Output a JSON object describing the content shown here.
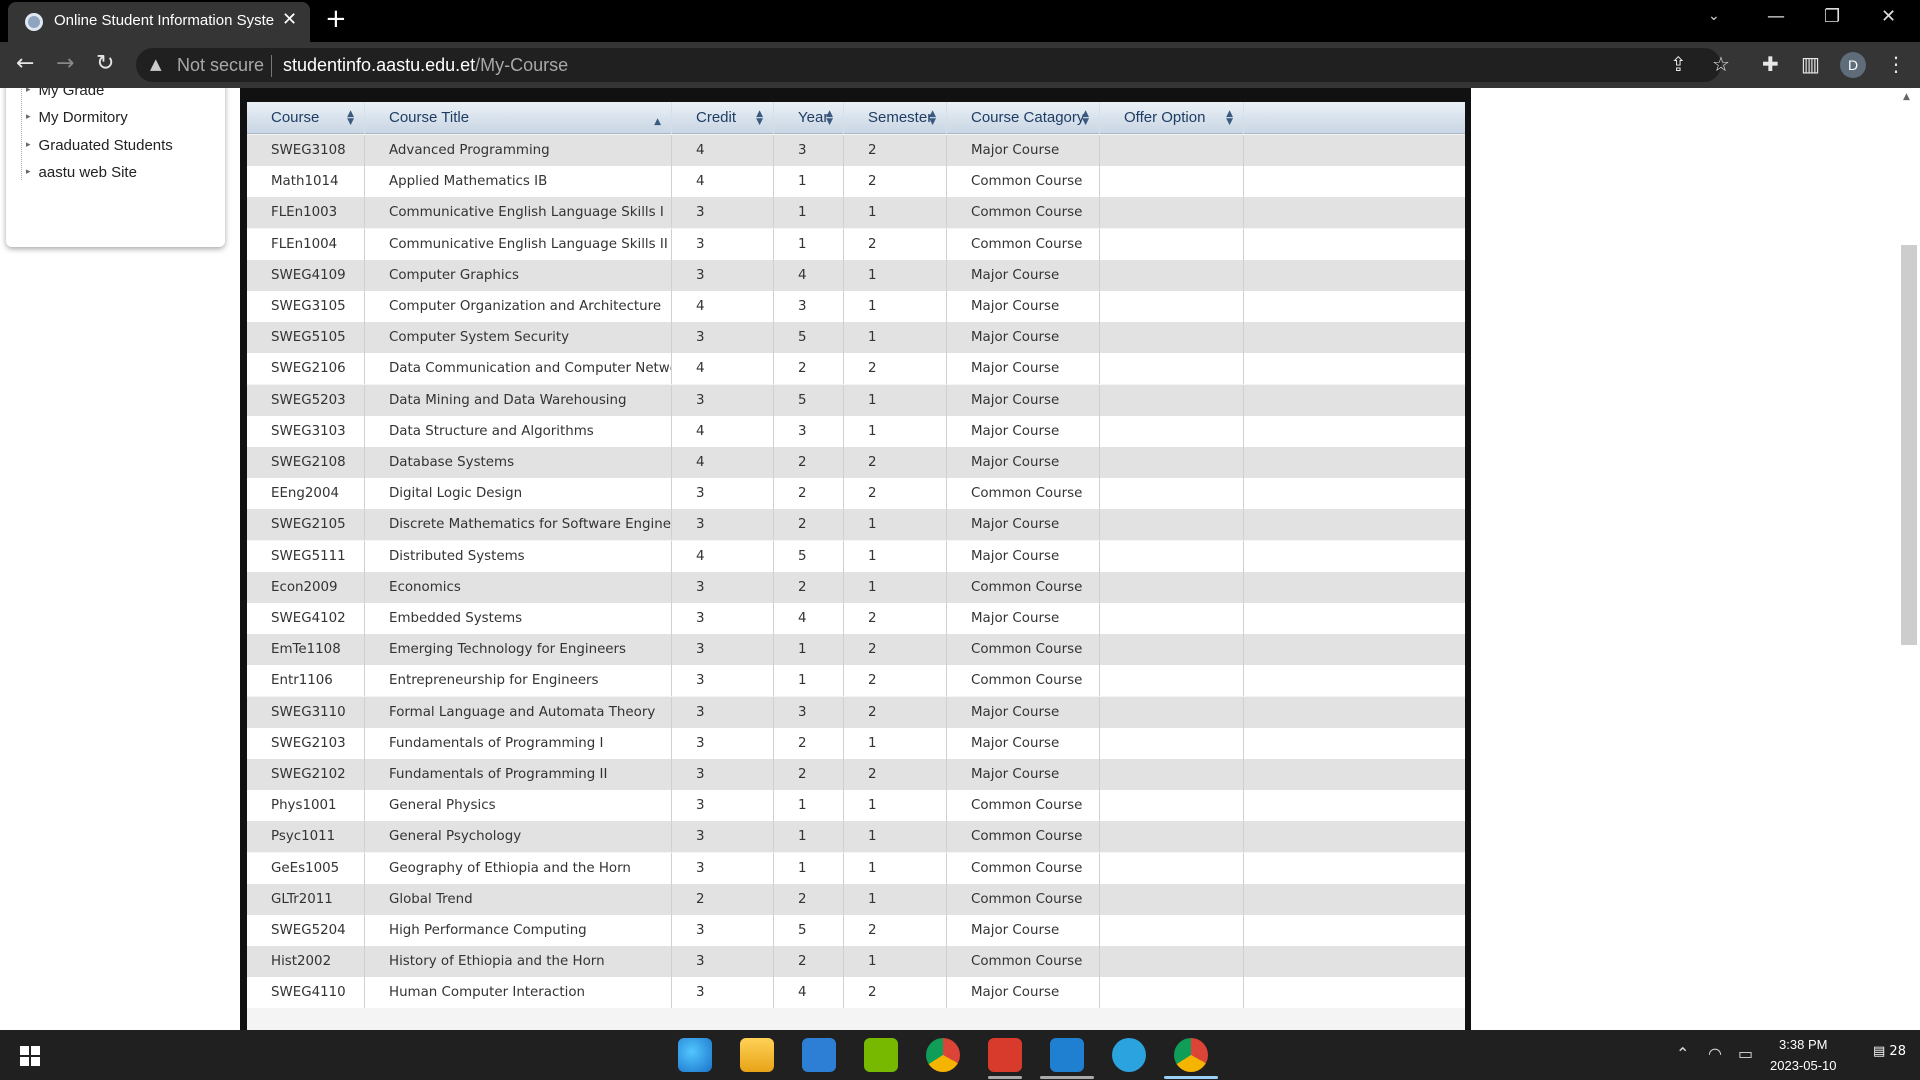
{
  "browser": {
    "tab_title": "Online Student Information Syste",
    "not_secure": "Not secure",
    "url_domain": "studentinfo.aastu.edu.et",
    "url_path": "/My-Course",
    "avatar_letter": "D"
  },
  "sidebar": {
    "items": [
      {
        "label": "My Grade"
      },
      {
        "label": "My Dormitory"
      },
      {
        "label": "Graduated Students"
      },
      {
        "label": "aastu web Site"
      }
    ]
  },
  "grid": {
    "columns": [
      "Course",
      "Course Title",
      "Credit",
      "Year",
      "Semester",
      "Course Catagory",
      "Offer Option"
    ],
    "rows": [
      [
        "SWEG3108",
        "Advanced Programming",
        "4",
        "3",
        "2",
        "Major Course",
        ""
      ],
      [
        "Math1014",
        "Applied Mathematics IB",
        "4",
        "1",
        "2",
        "Common Course",
        ""
      ],
      [
        "FLEn1003",
        "Communicative English Language Skills I",
        "3",
        "1",
        "1",
        "Common Course",
        ""
      ],
      [
        "FLEn1004",
        "Communicative English Language Skills II",
        "3",
        "1",
        "2",
        "Common Course",
        ""
      ],
      [
        "SWEG4109",
        "Computer Graphics",
        "3",
        "4",
        "1",
        "Major Course",
        ""
      ],
      [
        "SWEG3105",
        "Computer Organization and Architecture",
        "4",
        "3",
        "1",
        "Major Course",
        ""
      ],
      [
        "SWEG5105",
        "Computer System Security",
        "3",
        "5",
        "1",
        "Major Course",
        ""
      ],
      [
        "SWEG2106",
        "Data Communication and Computer Networks",
        "4",
        "2",
        "2",
        "Major Course",
        ""
      ],
      [
        "SWEG5203",
        "Data Mining and Data Warehousing",
        "3",
        "5",
        "1",
        "Major Course",
        ""
      ],
      [
        "SWEG3103",
        "Data Structure and Algorithms",
        "4",
        "3",
        "1",
        "Major Course",
        ""
      ],
      [
        "SWEG2108",
        "Database Systems",
        "4",
        "2",
        "2",
        "Major Course",
        ""
      ],
      [
        "EEng2004",
        "Digital Logic Design",
        "3",
        "2",
        "2",
        "Common Course",
        ""
      ],
      [
        "SWEG2105",
        "Discrete Mathematics for Software Engineering",
        "3",
        "2",
        "1",
        "Major Course",
        ""
      ],
      [
        "SWEG5111",
        "Distributed Systems",
        "4",
        "5",
        "1",
        "Major Course",
        ""
      ],
      [
        "Econ2009",
        "Economics",
        "3",
        "2",
        "1",
        "Common Course",
        ""
      ],
      [
        "SWEG4102",
        "Embedded Systems",
        "3",
        "4",
        "2",
        "Major Course",
        ""
      ],
      [
        "EmTe1108",
        "Emerging Technology for Engineers",
        "3",
        "1",
        "2",
        "Common Course",
        ""
      ],
      [
        "Entr1106",
        "Entrepreneurship for Engineers",
        "3",
        "1",
        "2",
        "Common Course",
        ""
      ],
      [
        "SWEG3110",
        "Formal Language and Automata Theory",
        "3",
        "3",
        "2",
        "Major Course",
        ""
      ],
      [
        "SWEG2103",
        "Fundamentals of Programming I",
        "3",
        "2",
        "1",
        "Major Course",
        ""
      ],
      [
        "SWEG2102",
        "Fundamentals of Programming II",
        "3",
        "2",
        "2",
        "Major Course",
        ""
      ],
      [
        "Phys1001",
        "General Physics",
        "3",
        "1",
        "1",
        "Common Course",
        ""
      ],
      [
        "Psyc1011",
        "General Psychology",
        "3",
        "1",
        "1",
        "Common Course",
        ""
      ],
      [
        "GeEs1005",
        "Geography of Ethiopia and the Horn",
        "3",
        "1",
        "1",
        "Common Course",
        ""
      ],
      [
        "GLTr2011",
        "Global Trend",
        "2",
        "2",
        "1",
        "Common Course",
        ""
      ],
      [
        "SWEG5204",
        "High Performance Computing",
        "3",
        "5",
        "2",
        "Major Course",
        ""
      ],
      [
        "Hist2002",
        "History of Ethiopia and the Horn",
        "3",
        "2",
        "1",
        "Common Course",
        ""
      ],
      [
        "SWEG4110",
        "Human Computer Interaction",
        "3",
        "4",
        "2",
        "Major Course",
        ""
      ]
    ]
  },
  "taskbar": {
    "time": "3:38 PM",
    "date": "2023-05-10",
    "notifications": "28"
  },
  "icons": {
    "back": "back-arrow-icon",
    "forward": "forward-arrow-icon",
    "reload": "reload-icon",
    "share": "share-icon",
    "bookmark": "star-icon",
    "extensions": "puzzle-icon",
    "sidepanel": "side-panel-icon",
    "menu": "kebab-menu-icon"
  }
}
